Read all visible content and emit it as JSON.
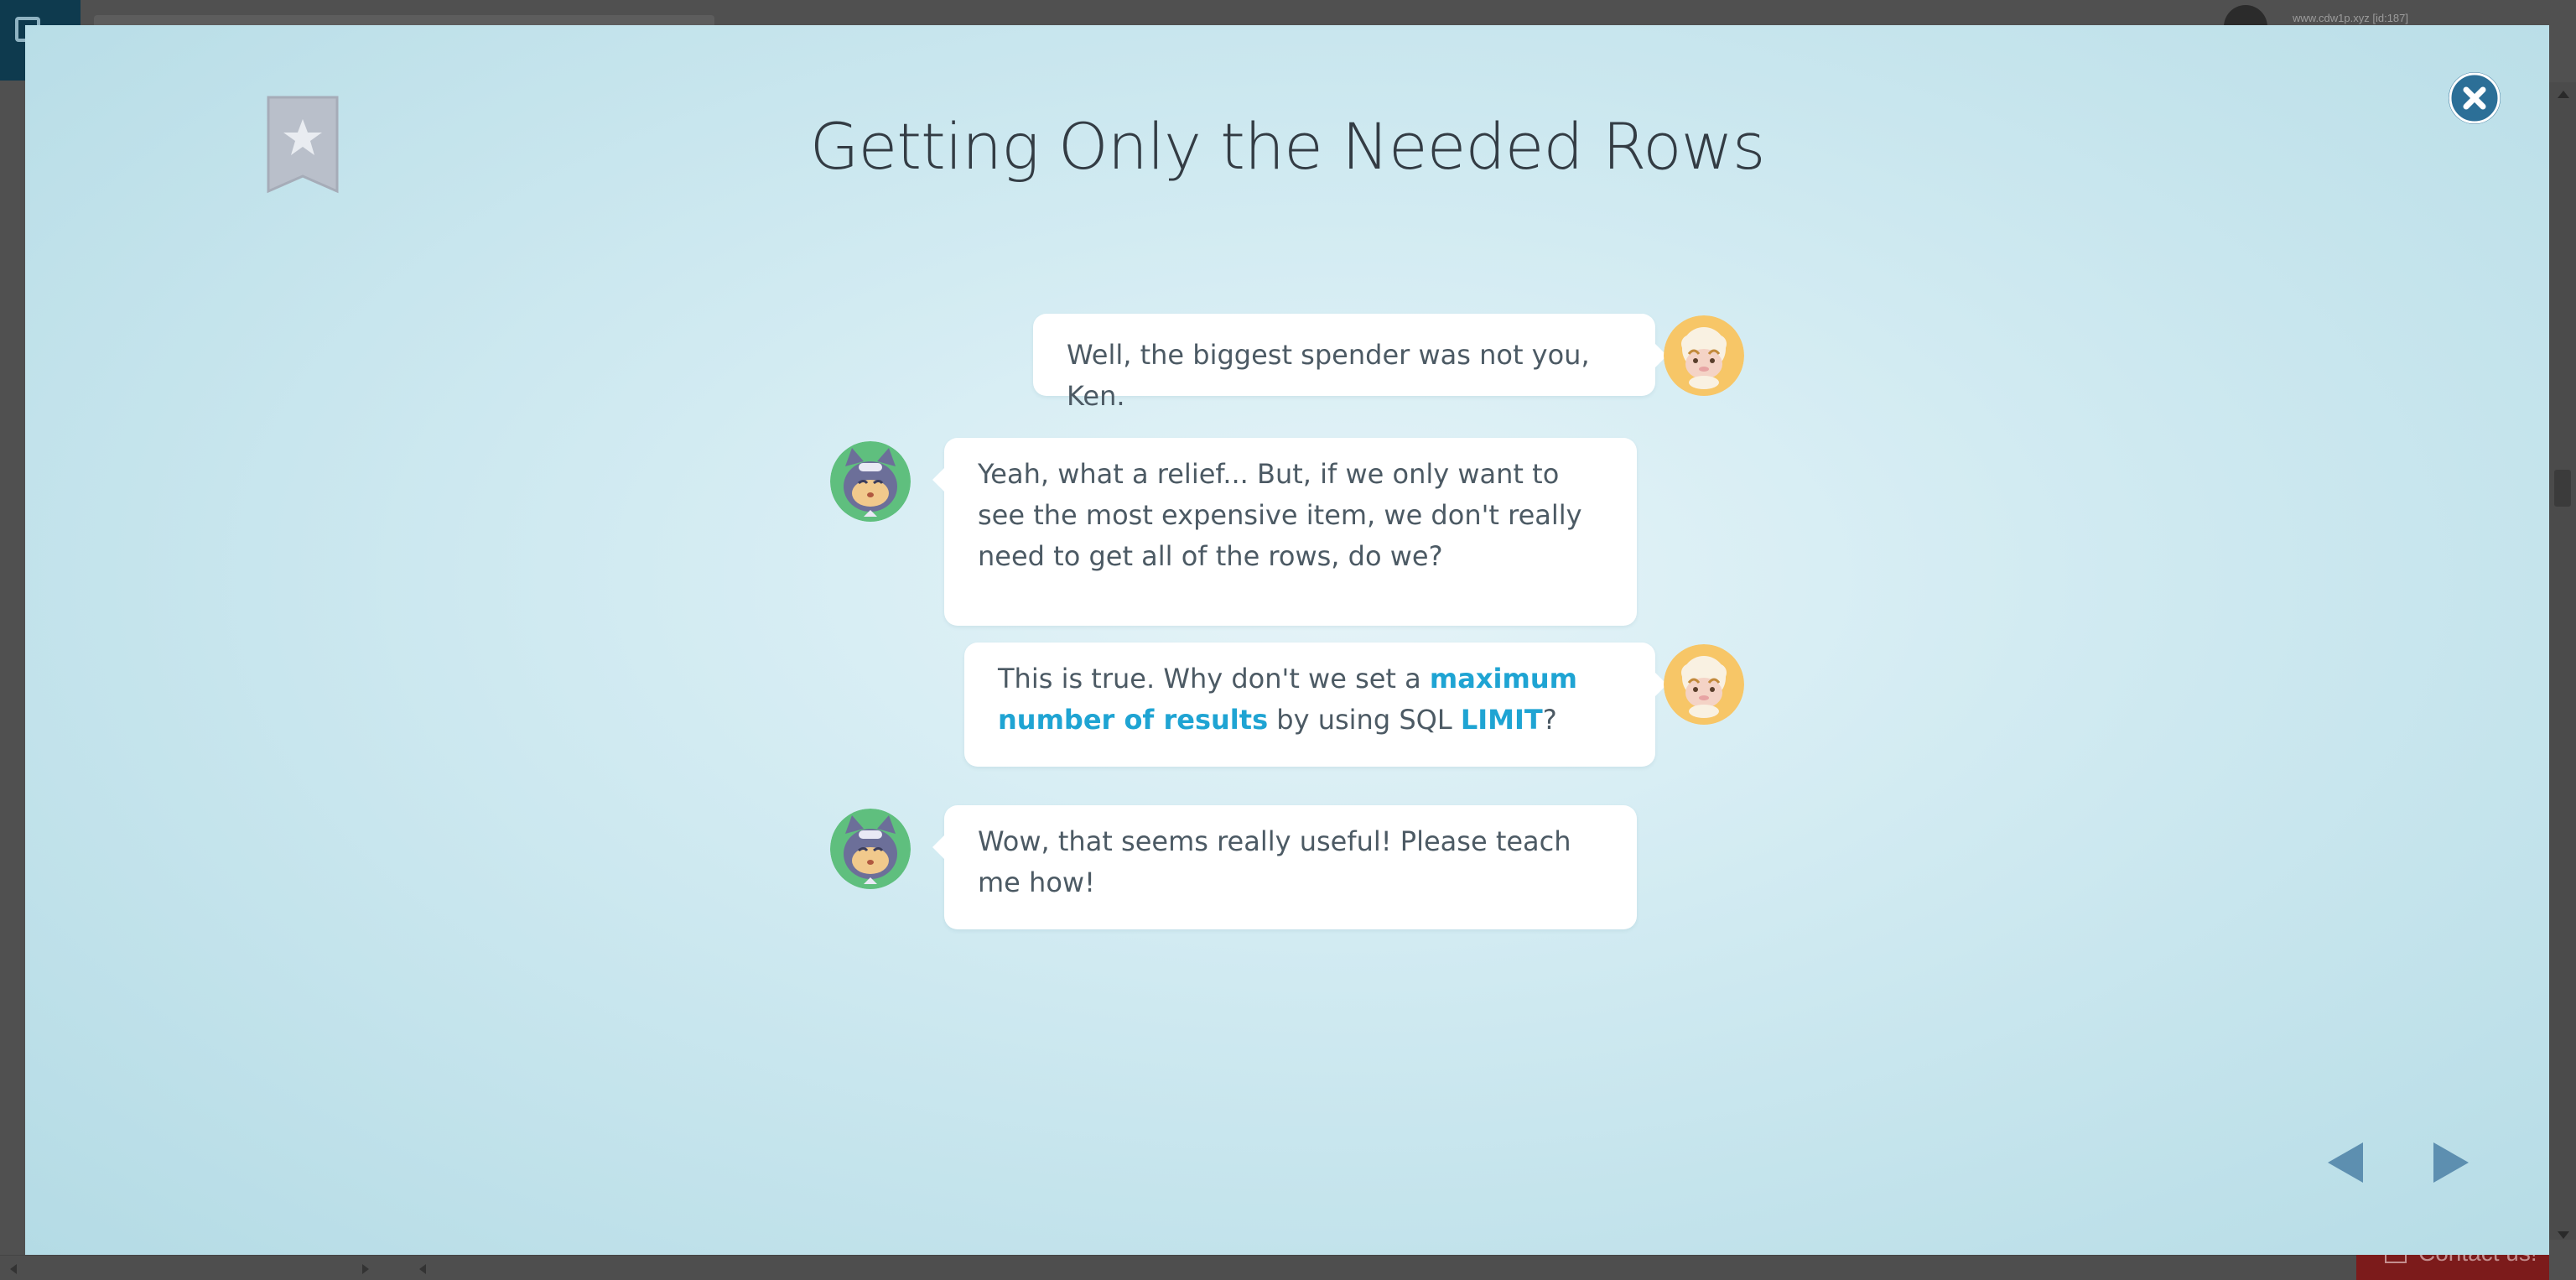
{
  "background": {
    "user_info": "www.cdw1p.xyz [id:187]",
    "contact_label": "Contact us!"
  },
  "modal": {
    "title": "Getting Only the Needed Rows",
    "colors": {
      "accent": "#1fa4d3",
      "close_button": "#2c6f97",
      "nav_arrow": "#5d8fb0",
      "bookmark": "#b9bfca"
    },
    "icons": {
      "bookmark": "bookmark-star-icon",
      "close": "close-icon",
      "prev": "arrow-left-icon",
      "next": "arrow-right-icon"
    },
    "messages": [
      {
        "speaker": "sheep",
        "side": "right",
        "parts": [
          {
            "text": "Well, the biggest spender was not you, Ken."
          }
        ]
      },
      {
        "speaker": "cat",
        "side": "left",
        "parts": [
          {
            "text": "Yeah, what a relief... But, if we only want to see the most expensive item, we don't really need to get all of the rows, do we?"
          }
        ]
      },
      {
        "speaker": "sheep",
        "side": "right",
        "parts": [
          {
            "text": "This is true. Why don't we set a "
          },
          {
            "text": "maximum number of results"
          },
          {
            "text": " by using SQL "
          },
          {
            "text": "LIMIT"
          },
          {
            "text": "?"
          }
        ]
      },
      {
        "speaker": "cat",
        "side": "left",
        "parts": [
          {
            "text": "Wow, that seems really useful! Please teach me how!"
          }
        ]
      }
    ]
  }
}
